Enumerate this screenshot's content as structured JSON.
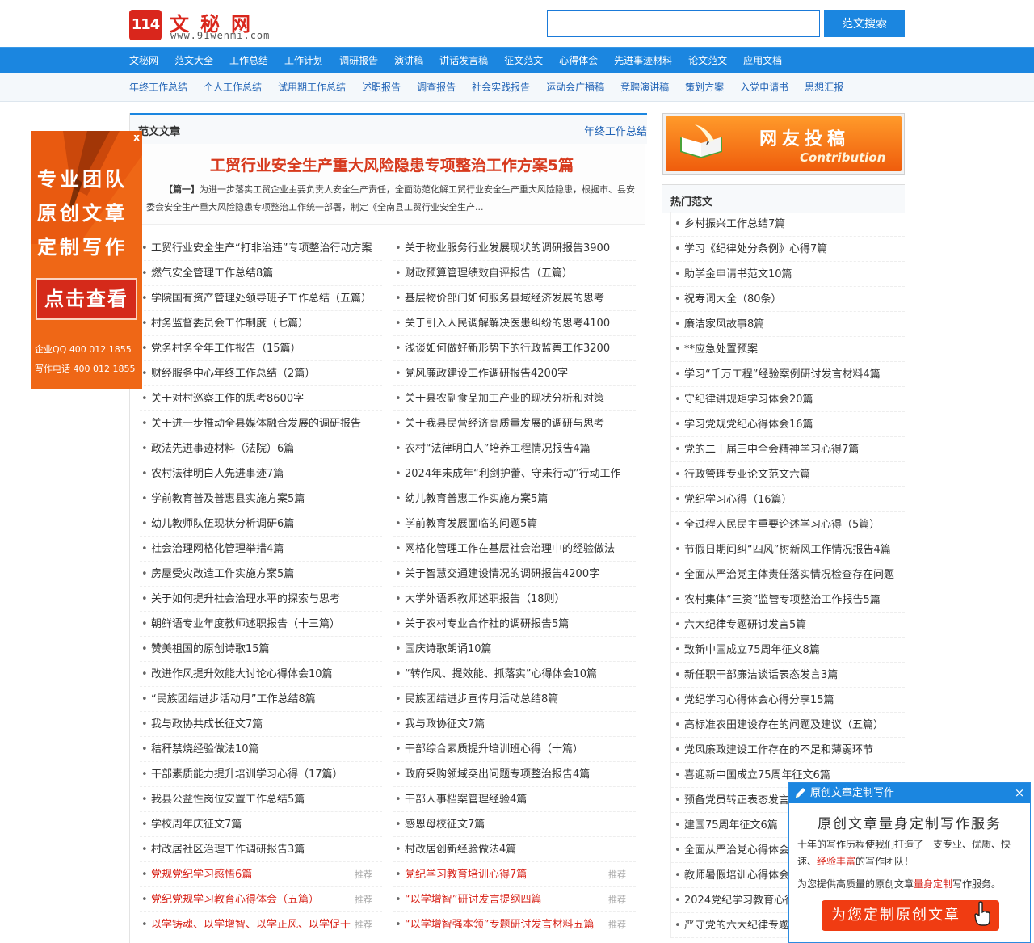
{
  "header": {
    "logo_number": "114",
    "logo_title": "文秘网",
    "logo_url": "www.91wenmi.com",
    "search_placeholder": "",
    "search_button": "范文搜索"
  },
  "nav": {
    "items": [
      "文秘网",
      "范文大全",
      "工作总结",
      "工作计划",
      "调研报告",
      "演讲稿",
      "讲话发言稿",
      "征文范文",
      "心得体会",
      "先进事迹材料",
      "论文范文",
      "应用文档"
    ]
  },
  "subnav": {
    "items": [
      "年终工作总结",
      "个人工作总结",
      "试用期工作总结",
      "述职报告",
      "调查报告",
      "社会实践报告",
      "运动会广播稿",
      "竞聘演讲稿",
      "策划方案",
      "入党申请书",
      "思想汇报"
    ]
  },
  "main": {
    "section_title": "范文文章",
    "section_link": "年终工作总结",
    "featured_title": "工贸行业安全生产重大风险隐患专项整治工作方案5篇",
    "featured_tag": "【篇一】",
    "featured_desc": "为进一步落实工贸企业主要负责人安全生产责任，全面防范化解工贸行业安全生产重大风险隐患，根据市、县安委会安全生产重大风险隐患专项整治工作统一部署，制定《全南县工贸行业安全生产...",
    "recommend_tag": "推荐",
    "col1": [
      "工贸行业安全生产“打非治违”专项整治行动方案",
      "燃气安全管理工作总结8篇",
      "学院国有资产管理处领导班子工作总结（五篇）",
      "村务监督委员会工作制度（七篇）",
      "党务村务全年工作报告（15篇）",
      "财经服务中心年终工作总结（2篇）",
      "关于对村巡察工作的思考8600字",
      "关于进一步推动全县媒体融合发展的调研报告",
      "政法先进事迹材料（法院）6篇",
      "农村法律明白人先进事迹7篇",
      "学前教育普及普惠县实施方案5篇",
      "幼儿教师队伍现状分析调研6篇",
      "社会治理网格化管理举措4篇",
      "房屋受灾改造工作实施方案5篇",
      "关于如何提升社会治理水平的探索与思考",
      "朝鲜语专业年度教师述职报告（十三篇）",
      "赞美祖国的原创诗歌15篇",
      "改进作风提升效能大讨论心得体会10篇",
      "“民族团结进步活动月”工作总结8篇",
      "我与政协共成长征文7篇",
      "秸秆禁烧经验做法10篇",
      "干部素质能力提升培训学习心得（17篇）",
      "我县公益性岗位安置工作总结5篇",
      "学校周年庆征文7篇",
      "村改居社区治理工作调研报告3篇"
    ],
    "col1_red": [
      "党规党纪学习感悟6篇",
      "党纪党规学习教育心得体会（五篇）",
      "以学铸魂、以学增智、以学正风、以学促干"
    ],
    "col2": [
      "关于物业服务行业发展现状的调研报告3900",
      "财政预算管理绩效自评报告（五篇）",
      "基层物价部门如何服务县域经济发展的思考",
      "关于引入人民调解解决医患纠纷的思考4100",
      "浅谈如何做好新形势下的行政监察工作3200",
      "党风廉政建设工作调研报告4200字",
      "关于县农副食品加工产业的现状分析和对策",
      "关于我县民营经济高质量发展的调研与思考",
      "农村“法律明白人”培养工程情况报告4篇",
      "2024年未成年“利剑护蕾、守未行动”行动工作",
      "幼儿教育普惠工作实施方案5篇",
      "学前教育发展面临的问题5篇",
      "网格化管理工作在基层社会治理中的经验做法",
      "关于智慧交通建设情况的调研报告4200字",
      "大学外语系教师述职报告（18则）",
      "关于农村专业合作社的调研报告5篇",
      "国庆诗歌朗诵10篇",
      "“转作风、提效能、抓落实”心得体会10篇",
      "民族团结进步宣传月活动总结8篇",
      "我与政协征文7篇",
      "干部综合素质提升培训班心得（十篇）",
      "政府采购领域突出问题专项整治报告4篇",
      "干部人事档案管理经验4篇",
      "感恩母校征文7篇",
      "村改居创新经验做法4篇"
    ],
    "col2_red": [
      "党纪学习教育培训心得7篇",
      "“以学增智”研讨发言提纲四篇",
      "“以学增智强本领”专题研讨发言材料五篇"
    ]
  },
  "side": {
    "contrib_cn": "网友投稿",
    "contrib_en": "Contribution",
    "hot_title": "热门范文",
    "hot_items": [
      "乡村振兴工作总结7篇",
      "学习《纪律处分条例》心得7篇",
      "助学金申请书范文10篇",
      "祝寿词大全（80条）",
      "廉洁家风故事8篇",
      "**应急处置预案",
      "学习“千万工程”经验案例研讨发言材料4篇",
      "守纪律讲规矩学习体会20篇",
      "学习党规党纪心得体会16篇",
      "党的二十届三中全会精神学习心得7篇",
      "行政管理专业论文范文六篇",
      "党纪学习心得（16篇）",
      "全过程人民民主重要论述学习心得（5篇）",
      "节假日期间纠“四风”树新风工作情况报告4篇",
      "全面从严治党主体责任落实情况检查存在问题",
      "农村集体“三资”监管专项整治工作报告5篇",
      "六大纪律专题研讨发言5篇",
      "致新中国成立75周年征文8篇",
      "新任职干部廉洁谈话表态发言3篇",
      "党纪学习心得体会心得分享15篇",
      "高标准农田建设存在的问题及建议（五篇）",
      "党风廉政建设工作存在的不足和薄弱环节",
      "喜迎新中国成立75周年征文6篇",
      "预备党员转正表态发言",
      "建国75周年征文6篇",
      "全面从严治党心得体会",
      "教师暑假培训心得体会",
      "2024党纪学习教育心得",
      "严守党的六大纪律专题"
    ]
  },
  "float_ad": {
    "close": "x",
    "line1": "专业团队",
    "line2": "原创文章",
    "line3": "定制写作",
    "button": "点击查看",
    "qq": "企业QQ  400 012 1855",
    "phone": "写作电话 400 012 1855"
  },
  "popup": {
    "title": "原创文章定制写作",
    "close": "×",
    "main": "原创文章量身定制写作服务",
    "desc_a": "十年的写作历程使我们打造了一支专业、优质、快速、",
    "desc_red1": "经验丰富",
    "desc_b": "的写作团队！",
    "desc2_a": "为您提供高质量的原创文章",
    "desc2_red": "量身定制",
    "desc2_b": "写作服务。",
    "button": "为您定制原创文章"
  },
  "colors": {
    "brand_blue": "#1b86e0",
    "brand_red": "#d9261c",
    "ad_orange": "#ef6716",
    "link_blue": "#1f62b5"
  }
}
